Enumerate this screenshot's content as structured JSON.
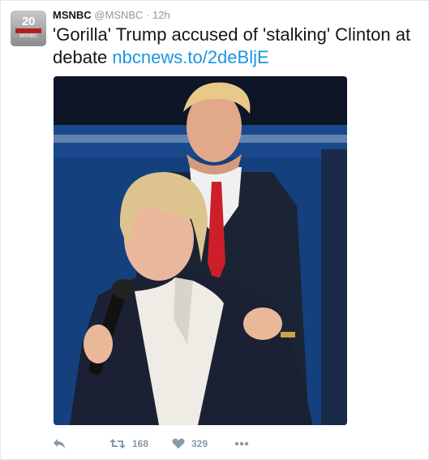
{
  "tweet": {
    "avatar_label": "20",
    "avatar_sub": "MSNBC",
    "name": "MSNBC",
    "handle": "@MSNBC",
    "separator": "·",
    "time": "12h",
    "text": "'Gorilla' Trump accused of 'stalking' Clinton at debate",
    "link": "nbcnews.to/2deBljE"
  },
  "actions": {
    "retweets": "168",
    "likes": "329"
  },
  "icons": {
    "reply": "reply-icon",
    "retweet": "retweet-icon",
    "like": "heart-icon",
    "more": "more-icon"
  },
  "colors": {
    "link": "#1b95e0",
    "muted": "#8899a6",
    "text": "#14171a",
    "stage_blue": "#123e86"
  }
}
